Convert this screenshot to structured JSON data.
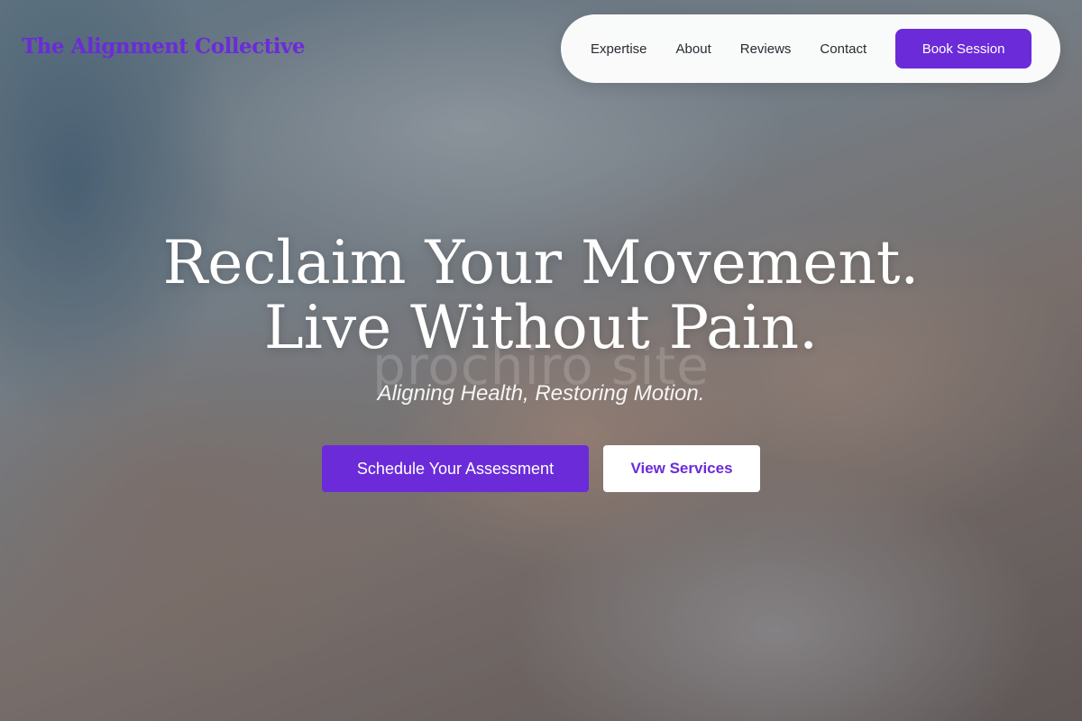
{
  "brand": {
    "name": "The Alignment Collective",
    "color": "#6b2bd9"
  },
  "nav": {
    "links": [
      "Expertise",
      "About",
      "Reviews",
      "Contact"
    ],
    "cta_label": "Book Session"
  },
  "hero": {
    "headline_line1": "Reclaim Your Movement.",
    "headline_line2": "Live Without Pain.",
    "watermark": "prochiro site",
    "tagline": "Aligning Health, Restoring Motion.",
    "primary_cta": "Schedule Your Assessment",
    "secondary_cta": "View Services"
  },
  "colors": {
    "accent": "#6b2bd9",
    "text_light": "#ffffff"
  }
}
